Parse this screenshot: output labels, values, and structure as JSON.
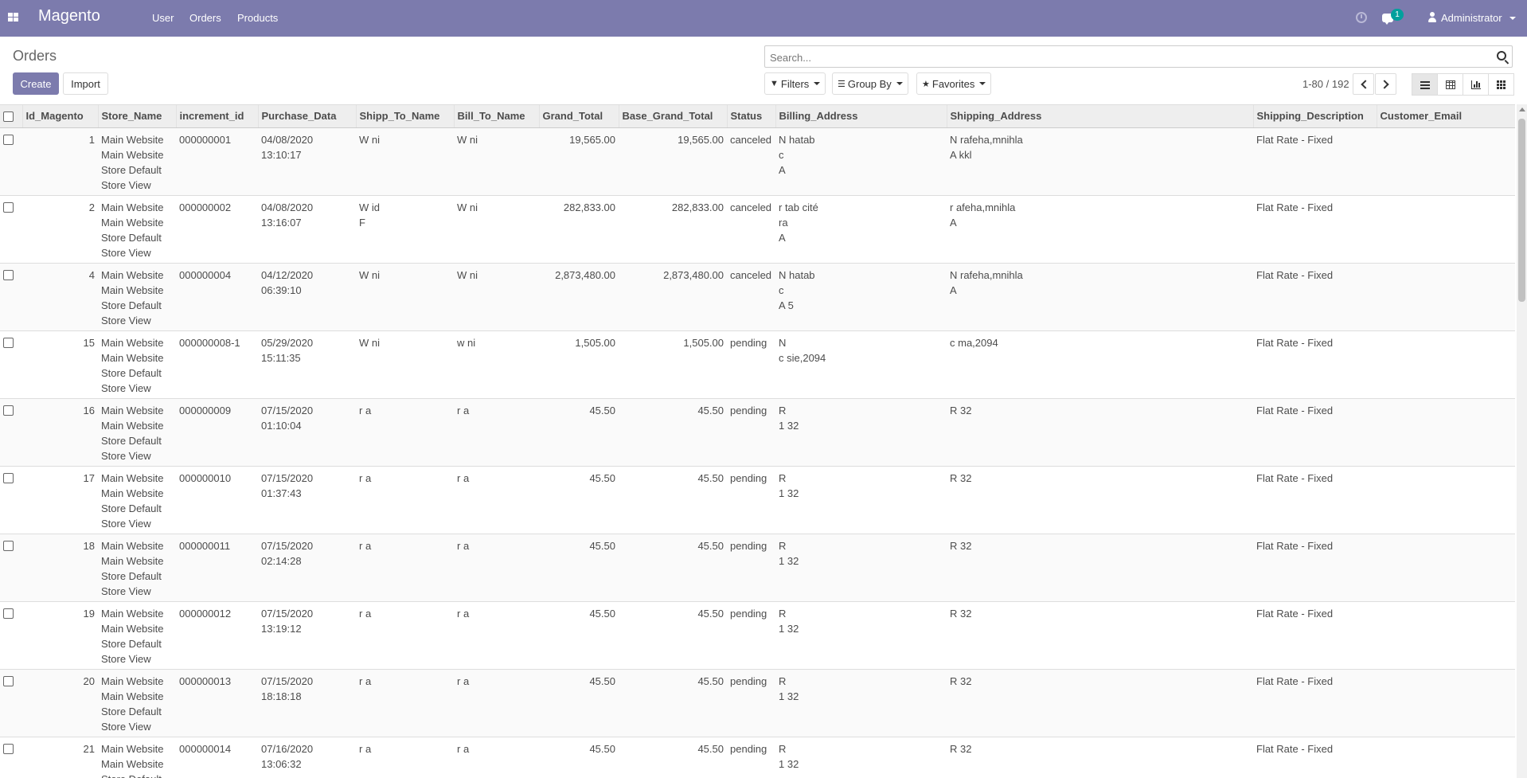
{
  "navbar": {
    "brand": "Magento",
    "menu": [
      "User",
      "Orders",
      "Products"
    ],
    "chat_badge": "1",
    "user_name": "Administrator"
  },
  "control_panel": {
    "breadcrumb": "Orders",
    "create_label": "Create",
    "import_label": "Import",
    "search_placeholder": "Search...",
    "filters_label": "Filters",
    "groupby_label": "Group By",
    "favorites_label": "Favorites",
    "pager_value": "1-80 / 192"
  },
  "table": {
    "columns": [
      "Id_Magento",
      "Store_Name",
      "increment_id",
      "Purchase_Data",
      "Shipp_To_Name",
      "Bill_To_Name",
      "Grand_Total",
      "Base_Grand_Total",
      "Status",
      "Billing_Address",
      "Shipping_Address",
      "Shipping_Description",
      "Customer_Email"
    ],
    "rows": [
      {
        "id": "1",
        "store": "Main Website\nMain Website\nStore Default\nStore View",
        "increment": "000000001",
        "date": "04/08/2020\n13:10:17",
        "ship_name": "W ni",
        "bill_name": "W ni",
        "grand_total": "19,565.00",
        "base_grand_total": "19,565.00",
        "status": "canceled",
        "billing": "N hatab\nc\nA",
        "shipping": "N rafeha,mnihla\nA kkl",
        "ship_desc": "Flat Rate - Fixed",
        "email": ""
      },
      {
        "id": "2",
        "store": "Main Website\nMain Website\nStore Default\nStore View",
        "increment": "000000002",
        "date": "04/08/2020\n13:16:07",
        "ship_name": "W id\nF",
        "bill_name": "W ni",
        "grand_total": "282,833.00",
        "base_grand_total": "282,833.00",
        "status": "canceled",
        "billing": "r tab cité\nra\nA",
        "shipping": "r afeha,mnihla\nA",
        "ship_desc": "Flat Rate - Fixed",
        "email": ""
      },
      {
        "id": "4",
        "store": "Main Website\nMain Website\nStore Default\nStore View",
        "increment": "000000004",
        "date": "04/12/2020\n06:39:10",
        "ship_name": "W ni",
        "bill_name": "W ni",
        "grand_total": "2,873,480.00",
        "base_grand_total": "2,873,480.00",
        "status": "canceled",
        "billing": "N hatab\nc\nA 5",
        "shipping": "N rafeha,mnihla\nA",
        "ship_desc": "Flat Rate - Fixed",
        "email": ""
      },
      {
        "id": "15",
        "store": "Main Website\nMain Website\nStore Default\nStore View",
        "increment": "000000008-1",
        "date": "05/29/2020\n15:11:35",
        "ship_name": "W ni",
        "bill_name": "w ni",
        "grand_total": "1,505.00",
        "base_grand_total": "1,505.00",
        "status": "pending",
        "billing": "N\nc sie,2094",
        "shipping": "c ma,2094",
        "ship_desc": "Flat Rate - Fixed",
        "email": ""
      },
      {
        "id": "16",
        "store": "Main Website\nMain Website\nStore Default\nStore View",
        "increment": "000000009",
        "date": "07/15/2020\n01:10:04",
        "ship_name": "r a",
        "bill_name": "r a",
        "grand_total": "45.50",
        "base_grand_total": "45.50",
        "status": "pending",
        "billing": "R\n1 32",
        "shipping": "R 32",
        "ship_desc": "Flat Rate - Fixed",
        "email": ""
      },
      {
        "id": "17",
        "store": "Main Website\nMain Website\nStore Default\nStore View",
        "increment": "000000010",
        "date": "07/15/2020\n01:37:43",
        "ship_name": "r a",
        "bill_name": "r a",
        "grand_total": "45.50",
        "base_grand_total": "45.50",
        "status": "pending",
        "billing": "R\n1 32",
        "shipping": "R 32",
        "ship_desc": "Flat Rate - Fixed",
        "email": ""
      },
      {
        "id": "18",
        "store": "Main Website\nMain Website\nStore Default\nStore View",
        "increment": "000000011",
        "date": "07/15/2020\n02:14:28",
        "ship_name": "r a",
        "bill_name": "r a",
        "grand_total": "45.50",
        "base_grand_total": "45.50",
        "status": "pending",
        "billing": "R\n1 32",
        "shipping": "R 32",
        "ship_desc": "Flat Rate - Fixed",
        "email": ""
      },
      {
        "id": "19",
        "store": "Main Website\nMain Website\nStore Default\nStore View",
        "increment": "000000012",
        "date": "07/15/2020\n13:19:12",
        "ship_name": "r a",
        "bill_name": "r a",
        "grand_total": "45.50",
        "base_grand_total": "45.50",
        "status": "pending",
        "billing": "R\n1 32",
        "shipping": "R 32",
        "ship_desc": "Flat Rate - Fixed",
        "email": ""
      },
      {
        "id": "20",
        "store": "Main Website\nMain Website\nStore Default\nStore View",
        "increment": "000000013",
        "date": "07/15/2020\n18:18:18",
        "ship_name": "r a",
        "bill_name": "r a",
        "grand_total": "45.50",
        "base_grand_total": "45.50",
        "status": "pending",
        "billing": "R\n1 32",
        "shipping": "R 32",
        "ship_desc": "Flat Rate - Fixed",
        "email": ""
      },
      {
        "id": "21",
        "store": "Main Website\nMain Website\nStore Default\nStore View",
        "increment": "000000014",
        "date": "07/16/2020\n13:06:32",
        "ship_name": "r a",
        "bill_name": "r a",
        "grand_total": "45.50",
        "base_grand_total": "45.50",
        "status": "pending",
        "billing": "R\n1 32",
        "shipping": "R 32",
        "ship_desc": "Flat Rate - Fixed",
        "email": ""
      }
    ]
  },
  "colors": {
    "brand": "#7c7bad",
    "badge": "#00a09d"
  }
}
